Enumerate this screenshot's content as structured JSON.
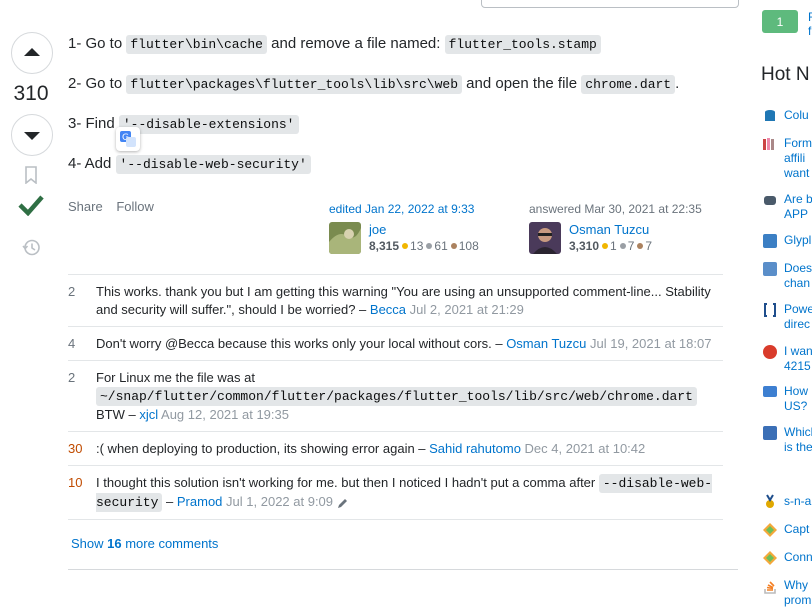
{
  "vote": {
    "count": "310"
  },
  "answer": {
    "step1_prefix": "1- Go to ",
    "step1_code": "flutter\\bin\\cache",
    "step1_mid": " and remove a file named: ",
    "step1_code2": "flutter_tools.stamp",
    "step2_prefix": "2- Go to ",
    "step2_code": "flutter\\packages\\flutter_tools\\lib\\src\\web",
    "step2_mid": " and open the file ",
    "step2_code2": "chrome.dart",
    "step2_suffix": ".",
    "step3_prefix": "3- Find ",
    "step3_code": "'--disable-extensions'",
    "step4_prefix": "4- Add ",
    "step4_code": "'--disable-web-security'"
  },
  "post_menu": {
    "share": "Share",
    "follow": "Follow"
  },
  "editor": {
    "action": "edited Jan 22, 2022 at 9:33",
    "name": "joe",
    "rep": "8,315",
    "gold": "13",
    "silver": "61",
    "bronze": "108"
  },
  "owner": {
    "action": "answered Mar 30, 2021 at 22:35",
    "name": "Osman Tuzcu",
    "rep": "3,310",
    "gold": "1",
    "silver": "7",
    "bronze": "7"
  },
  "comments": [
    {
      "score": "2",
      "text": "This works. thank you but I am getting this warning \"You are using an unsupported comment-line... Stability and security will suffer.\", should I be worried? – ",
      "user": "Becca",
      "date": "Jul 2, 2021 at 21:29"
    },
    {
      "score": "4",
      "text": "Don't worry @Becca because this works only your local without cors. – ",
      "user": "Osman Tuzcu",
      "date": "Jul 19, 2021 at 18:07"
    },
    {
      "score": "2",
      "text_prefix": "For Linux me the file was at ",
      "code": "~/snap/flutter/common/flutter/packages/flutter_tools/lib/src/web/chrome.dart",
      "text_suffix": " BTW – ",
      "user": "xjcl",
      "date": "Aug 12, 2021 at 19:35"
    },
    {
      "score": "30",
      "text": ":( when deploying to production, its showing error again – ",
      "user": "Sahid rahutomo",
      "date": "Dec 4, 2021 at 10:42"
    },
    {
      "score": "10",
      "text_prefix": "I thought this solution isn't working for me. but then I noticed I hadn't put a comma after ",
      "code": "--disable-web-security",
      "text_suffix": " – ",
      "user": "Pramod",
      "date": "Jul 1, 2022 at 9:09"
    }
  ],
  "more_comments": {
    "prefix": "Show ",
    "count": "16",
    "suffix": " more comments"
  },
  "sidebar": {
    "green_label": "1",
    "hot_title": "Hot N",
    "items": [
      "Colu",
      "Form affili want",
      "Are b APP",
      "Glypl",
      "Does chan",
      "Powe direc",
      "I wan 4215",
      "How US?",
      "Which is the",
      "s-n-a",
      "Capt",
      "Conn",
      "Why prom"
    ],
    "colors": {
      "accent": "#0074cc",
      "accepted": "#2f6f44",
      "green": "#5eba7d"
    }
  }
}
